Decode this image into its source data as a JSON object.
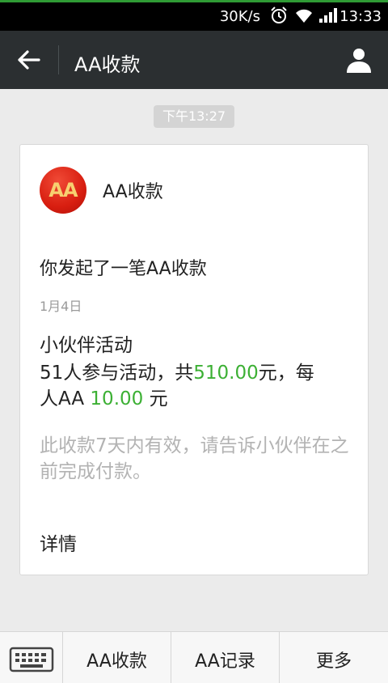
{
  "status_bar": {
    "network_speed": "30K/s",
    "icons": [
      "alarm-icon",
      "wifi-icon",
      "signal-icon"
    ],
    "time": "13:33"
  },
  "header": {
    "back_icon": "back-arrow-icon",
    "title": "AA收款",
    "profile_icon": "person-icon"
  },
  "chat": {
    "timestamp": "下午13:27"
  },
  "card": {
    "logo_text": "AA",
    "app_name": "AA收款",
    "headline": "你发起了一笔AA收款",
    "date": "1月4日",
    "activity_name": "小伙伴活动",
    "line1_prefix": "51人参与活动，共",
    "total_amount": "510.00",
    "line1_suffix": "元，每",
    "line2_prefix": "人AA",
    "per_person_amount": "10.00",
    "line2_suffix": "元",
    "validity_note": "此收款7天内有效，请告诉小伙伴在之前完成付款。",
    "details_link": "详情"
  },
  "bottom_menu": {
    "keyboard_icon": "keyboard-icon",
    "tabs": [
      {
        "label": "AA收款"
      },
      {
        "label": "AA记录"
      },
      {
        "label": "更多"
      }
    ]
  },
  "colors": {
    "header_bg": "#2b2f31",
    "amount_green": "#3cb034",
    "logo_red": "#d81e10",
    "status_accent": "#2f9b35"
  }
}
